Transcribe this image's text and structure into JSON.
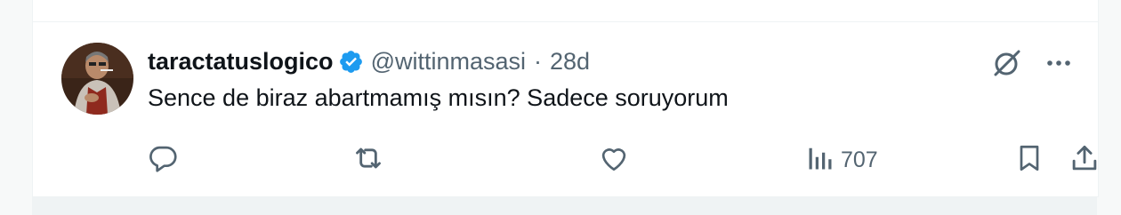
{
  "tweet": {
    "display_name": "taractatuslogico",
    "handle": "@wittinmasasi",
    "separator": "·",
    "time": "28d",
    "text": "Sence de biraz abartmamış mısın? Sadece soruyorum",
    "verified": true,
    "views": "707"
  },
  "icons": {
    "verified": "verified-badge-icon",
    "grok": "grok-icon",
    "more": "more-icon",
    "reply": "reply-icon",
    "retweet": "retweet-icon",
    "like": "like-icon",
    "views": "views-icon",
    "bookmark": "bookmark-icon",
    "share": "share-icon"
  },
  "colors": {
    "text_primary": "#0f1419",
    "text_secondary": "#536471",
    "verified": "#1d9bf0",
    "border": "#eff3f4"
  }
}
